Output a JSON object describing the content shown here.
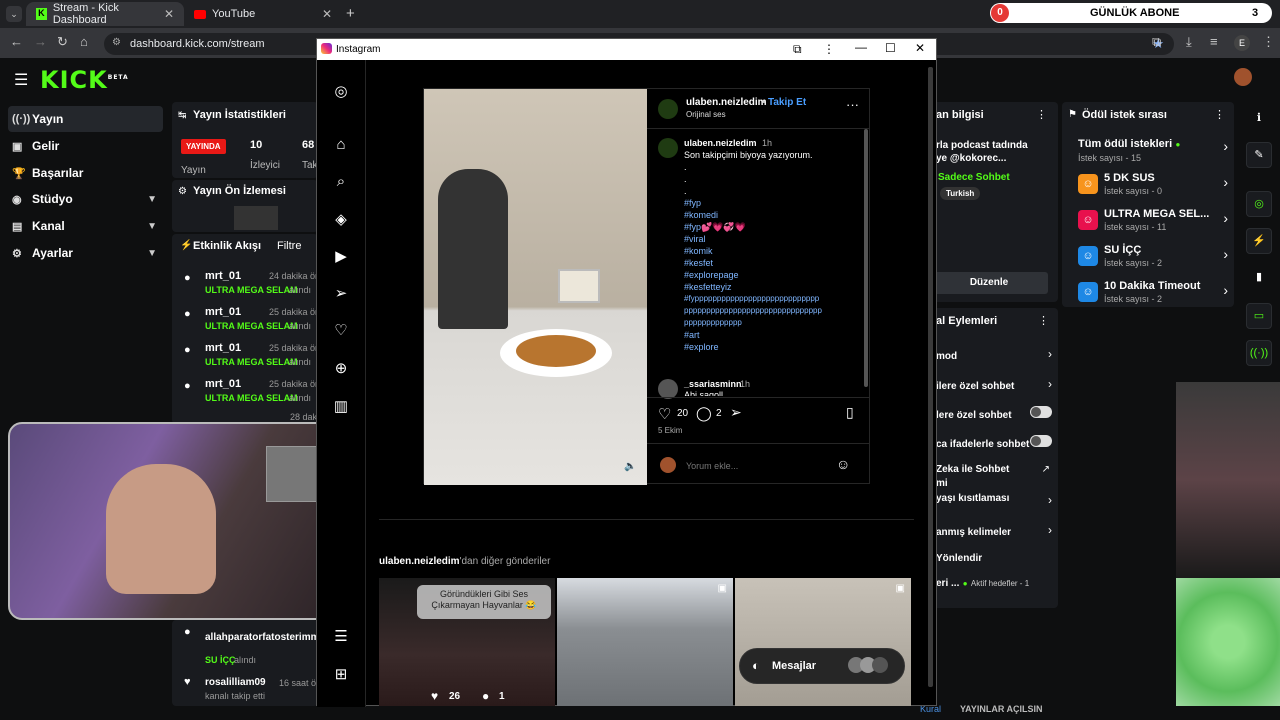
{
  "browser": {
    "tabs": [
      {
        "label": "Stream - Kick Dashboard"
      },
      {
        "label": "YouTube"
      }
    ],
    "url": "dashboard.kick.com/stream",
    "abone_left": "0",
    "abone_title": "GÜNLÜK ABONE",
    "abone_right": "3",
    "profile_letter": "E"
  },
  "kick": {
    "logo": "KICK",
    "logo_badge": "BETA",
    "sidebar": [
      {
        "label": "Yayın",
        "icon": "broadcast-icon"
      },
      {
        "label": "Gelir",
        "icon": "money-icon"
      },
      {
        "label": "Başarılar",
        "icon": "trophy-icon"
      },
      {
        "label": "Stüdyo",
        "icon": "studio-icon"
      },
      {
        "label": "Kanal",
        "icon": "channel-icon"
      },
      {
        "label": "Ayarlar",
        "icon": "settings-icon"
      }
    ],
    "stats": {
      "title": "Yayın İstatistikleri",
      "status": "YAYINDA",
      "status_label": "Yayın",
      "viewers": "10",
      "viewers_label": "İzleyici",
      "third": "68",
      "third_label": "Tak"
    },
    "preview": {
      "title": "Yayın Ön İzlemesi"
    },
    "feed": {
      "title": "Etkinlik Akışı",
      "filter": "Filtre",
      "items": [
        {
          "user": "mrt_01",
          "time": "24 dakika ön",
          "item": "ULTRA MEGA SELAM",
          "action": "alındı"
        },
        {
          "user": "mrt_01",
          "time": "25 dakika ön",
          "item": "ULTRA MEGA SELAM",
          "action": "alındı"
        },
        {
          "user": "mrt_01",
          "time": "25 dakika ön",
          "item": "ULTRA MEGA SELAM",
          "action": "alındı"
        },
        {
          "user": "mrt_01",
          "time": "25 dakika ön",
          "item": "ULTRA MEGA SELAM",
          "action": "alındı"
        }
      ],
      "partial_time": "28 dak",
      "bottom": [
        {
          "user": "allahparatorfatosterimm",
          "item": "SU İÇÇ",
          "action": "alındı"
        },
        {
          "user": "rosalilliam09",
          "time": "16 saat ön",
          "action": "kanalı takip etti"
        }
      ]
    },
    "info": {
      "title": "an bilgisi",
      "line1": "rla podcast tadında",
      "line2": "ye @kokorec...",
      "category": "Sadece Sohbet",
      "lang": "Turkish",
      "edit": "Düzenle"
    },
    "mod": {
      "title": "al Eylemleri",
      "rows": [
        {
          "label": "mod"
        },
        {
          "label": "ilere özel sohbet"
        },
        {
          "label": "lere özel sohbet"
        },
        {
          "label": "ca ifadelerle sohbet"
        },
        {
          "label": "Zeka ile Sohbet",
          "label2": "mi"
        },
        {
          "label": "yaşı kısıtlaması"
        },
        {
          "label": "anmış kelimeler"
        },
        {
          "label": "Yönlendir"
        },
        {
          "label": "eri ...",
          "extra": "Aktif hedefler - 1"
        }
      ]
    },
    "rewards": {
      "title": "Ödül istek sırası",
      "all": {
        "label": "Tüm ödül istekleri",
        "sub": "İstek sayısı - 15"
      },
      "items": [
        {
          "label": "5 DK SUS",
          "sub": "İstek sayısı - 0",
          "color": "#f7941d"
        },
        {
          "label": "ULTRA MEGA SEL...",
          "sub": "İstek sayısı - 11",
          "color": "#e8114d"
        },
        {
          "label": "SU İÇÇ",
          "sub": "İstek sayısı - 2",
          "color": "#1e88e5"
        },
        {
          "label": "10 Dakika Timeout",
          "sub": "İstek sayısı - 2",
          "color": "#1e88e5"
        }
      ]
    },
    "bottom_text": "YAYINLAR AÇILSIN",
    "bottom_prefix": "Kural"
  },
  "instagram": {
    "window_title": "Instagram",
    "post": {
      "username": "ulaben.neizledim",
      "follow": "Takip Et",
      "audio": "Orijinal ses",
      "caption_user": "ulaben.neizledim",
      "caption_time": "1h",
      "caption": "Son takipçimi biyoya yazıyorum.",
      "dots": ".",
      "hashtags": [
        "#fyp",
        "#komedi",
        "#fyp💕💗💞💗",
        "#viral",
        "#komik",
        "#kesfet",
        "#explorepage",
        "#kesfetteyiz",
        "#fypppppppppppppppppppppppppppp",
        "ppppppppppppppppppppppppppppppp",
        "ppppppppppppp",
        "#art",
        "#explore"
      ],
      "comment_user": "_ssariasminn",
      "comment_time": "1h",
      "comment_text": "Abi sagoll",
      "likes": "20",
      "comments": "2",
      "date": "5 Ekim",
      "comment_placeholder": "Yorum ekle..."
    },
    "more": {
      "user": "ulaben.neizledim",
      "suffix": "'dan diğer gönderiler"
    },
    "thumb1": {
      "caption": "Göründükleri Gibi Ses Çıkarmayan Hayvanlar 😂",
      "likes": "26",
      "comments": "1"
    },
    "messages": "Mesajlar"
  }
}
